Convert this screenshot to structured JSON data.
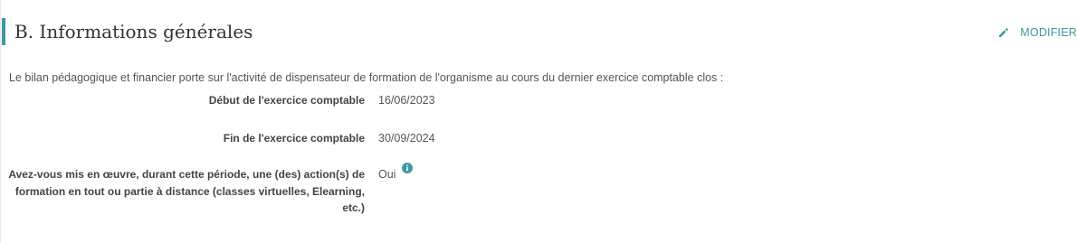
{
  "section": {
    "title": "B. Informations générales",
    "edit_label": "MODIFIER",
    "edit_icon": "pencil-icon",
    "accent_color": "#3e98a3"
  },
  "intro": "Le bilan pédagogique et financier porte sur l'activité de dispensateur de formation de l'organisme au cours du dernier exercice comptable clos :",
  "fields": [
    {
      "label": "Début de l'exercice comptable",
      "value": "16/06/2023"
    },
    {
      "label": "Fin de l'exercice comptable",
      "value": "30/09/2024"
    },
    {
      "label": "Avez-vous mis en œuvre, durant cette période, une (des) action(s) de formation en tout ou partie à distance (classes virtuelles, Elearning, etc.)",
      "value": "Oui",
      "icon": "info-icon"
    }
  ]
}
